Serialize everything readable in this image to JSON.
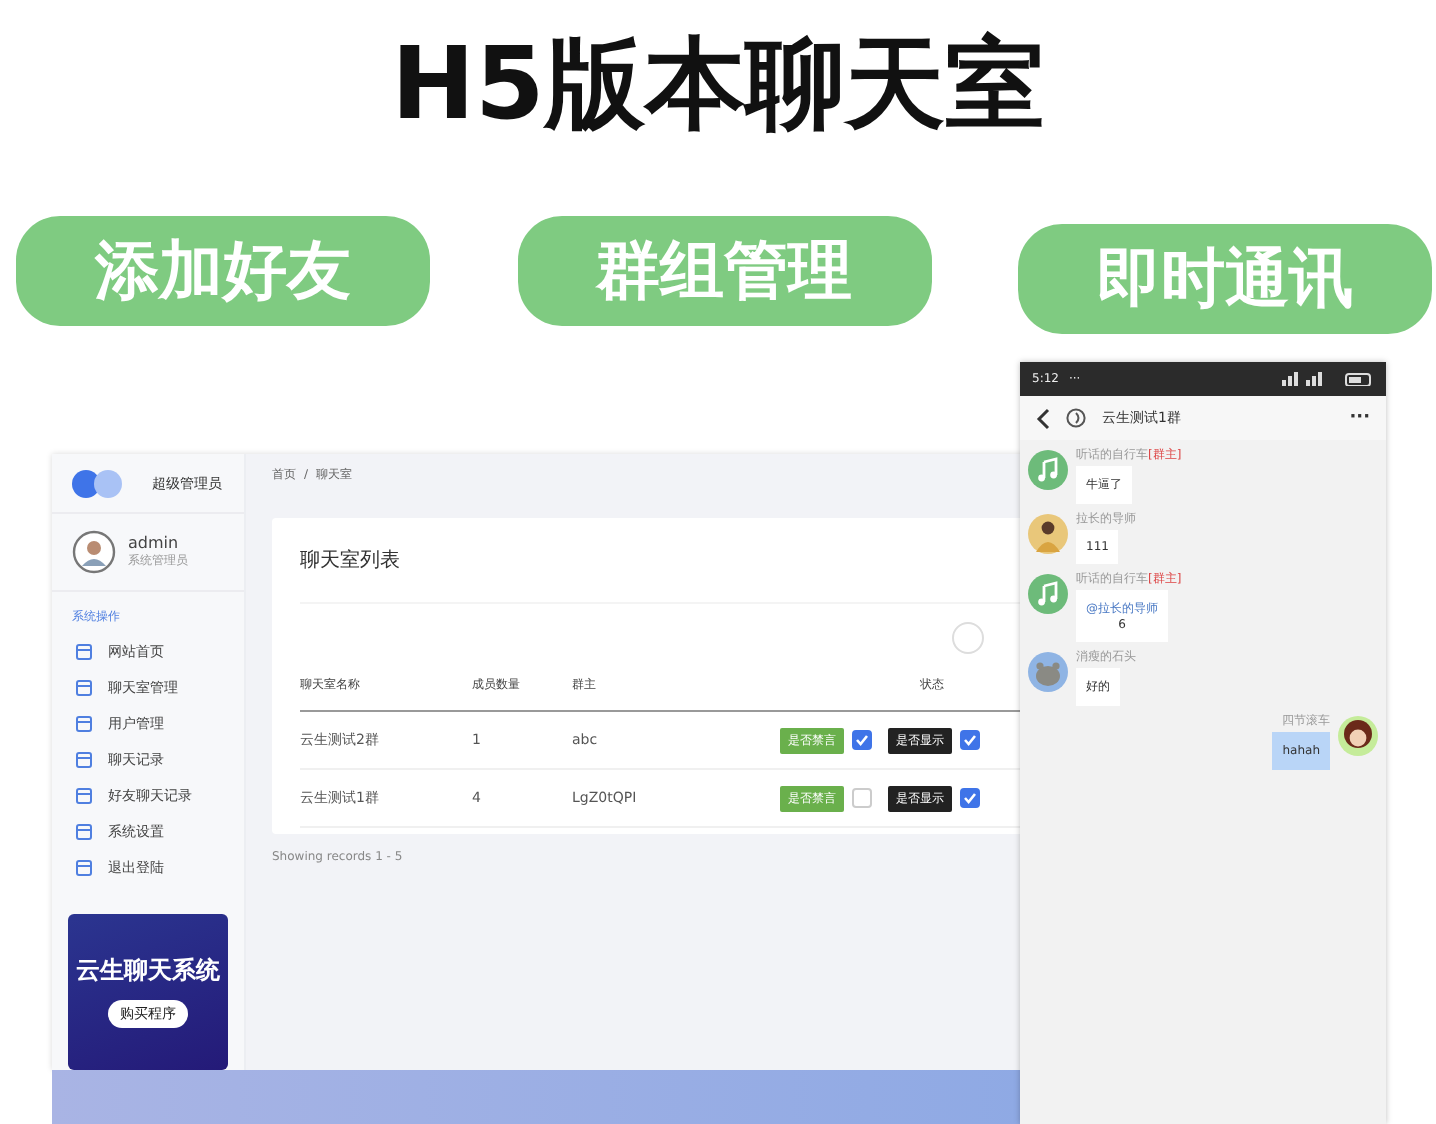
{
  "title": "H5版本聊天室",
  "features": [
    "添加好友",
    "群组管理",
    "即时通讯"
  ],
  "admin": {
    "brand": "超级管理员",
    "user": {
      "name": "admin",
      "role": "系统管理员"
    },
    "section": "系统操作",
    "menu": [
      "网站首页",
      "聊天室管理",
      "用户管理",
      "聊天记录",
      "好友聊天记录",
      "系统设置",
      "退出登陆"
    ],
    "promo": {
      "title": "云生聊天系统",
      "button": "购买程序"
    },
    "breadcrumb": [
      "首页",
      "/",
      "聊天室"
    ],
    "card_title": "聊天室列表",
    "columns": [
      "聊天室名称",
      "成员数量",
      "群主",
      "状态"
    ],
    "rows": [
      {
        "name": "云生测试2群",
        "count": "1",
        "owner": "abc",
        "mute": {
          "label": "是否禁言",
          "checked": true
        },
        "show": {
          "label": "是否显示",
          "checked": true
        }
      },
      {
        "name": "云生测试1群",
        "count": "4",
        "owner": "LgZ0tQPI",
        "mute": {
          "label": "是否禁言",
          "checked": false
        },
        "show": {
          "label": "是否显示",
          "checked": true
        }
      }
    ],
    "footer": "Showing records 1 - 5"
  },
  "phone": {
    "time": "5:12",
    "dots": "···",
    "chat_title": "云生测试1群",
    "more": "···",
    "messages": [
      {
        "kind": "received",
        "avatar": {
          "kind": "music"
        },
        "sender": "听话的自行车",
        "tag": "[群主]",
        "text": "牛逼了"
      },
      {
        "kind": "received",
        "avatar": {
          "kind": "person"
        },
        "sender": "拉长的导师",
        "text": "111"
      },
      {
        "kind": "received",
        "avatar": {
          "kind": "music"
        },
        "sender": "听话的自行车",
        "tag": "[群主]",
        "mention": "@拉长的导师",
        "text": "6"
      },
      {
        "kind": "received",
        "avatar": {
          "kind": "animal"
        },
        "sender": "消瘦的石头",
        "text": "好的"
      },
      {
        "kind": "sent",
        "avatar": {
          "kind": "cartoon"
        },
        "sender": "四节滚车",
        "text": "hahah"
      }
    ]
  }
}
